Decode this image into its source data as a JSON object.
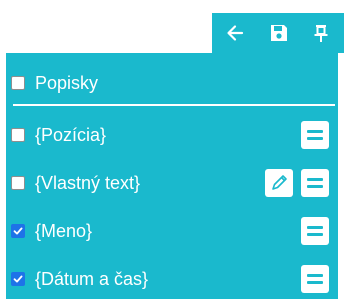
{
  "toolbar": {
    "back_icon": "arrow-left-icon",
    "save_icon": "floppy-disk-icon",
    "pin_icon": "pushpin-icon"
  },
  "header": {
    "label": "Popisky",
    "checked": false
  },
  "items": [
    {
      "label": "{Pozícia}",
      "checked": false,
      "editable": false
    },
    {
      "label": "{Vlastný text}",
      "checked": false,
      "editable": true
    },
    {
      "label": "{Meno}",
      "checked": true,
      "editable": false
    },
    {
      "label": "{Dátum a čas}",
      "checked": true,
      "editable": false
    }
  ],
  "colors": {
    "accent": "#1ab9cd",
    "checkbox_checked": "#1e73e8",
    "text": "#ffffff"
  },
  "icons": {
    "drag_handle": "drag-handle-icon",
    "edit": "pencil-icon"
  }
}
